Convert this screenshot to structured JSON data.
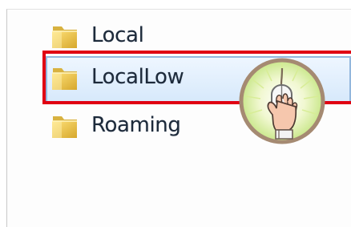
{
  "explorer": {
    "folders": [
      {
        "label": "Local",
        "icon": "folder-icon",
        "selected": false
      },
      {
        "label": "LocalLow",
        "icon": "folder-icon",
        "selected": true
      },
      {
        "label": "Roaming",
        "icon": "folder-icon",
        "selected": false
      }
    ]
  },
  "annotation": {
    "highlight_color": "#e00012",
    "cursor_icon": "hand-mouse-click-icon",
    "badge_color": "#d8f09a",
    "badge_border_color": "#a58a72"
  },
  "colors": {
    "selection_fill": "#d7e9fb",
    "selection_border": "#93b7dd",
    "folder_yellow": "#f2cf4f",
    "folder_shadow": "#c79a21",
    "text": "#1d2a3a"
  }
}
